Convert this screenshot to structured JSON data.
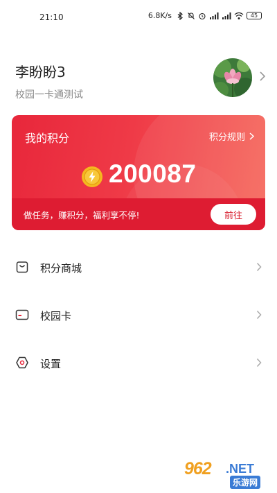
{
  "status_bar": {
    "time": "21:10",
    "speed": "6.8K/s",
    "battery": "45",
    "icons": [
      "bluetooth-icon",
      "mute-icon",
      "alarm-icon",
      "hd-signal-icon",
      "hd-signal-icon",
      "wifi-icon",
      "battery-icon"
    ]
  },
  "profile": {
    "name": "李盼盼3",
    "subtitle": "校园一卡通测试",
    "avatar_icon": "lotus-flower-avatar"
  },
  "points_card": {
    "title": "我的积分",
    "rules_label": "积分规则",
    "value": "200087",
    "slogan": "做任务，赚积分，福利享不停!",
    "go_label": "前往",
    "colors": {
      "primary": "#e8273b",
      "bottom_bar": "#de1c32",
      "coin": "#f5b81f"
    }
  },
  "menu": {
    "items": [
      {
        "label": "积分商城",
        "icon": "shopping-bag-icon"
      },
      {
        "label": "校园卡",
        "icon": "card-icon"
      },
      {
        "label": "设置",
        "icon": "settings-hexagon-icon"
      }
    ]
  },
  "watermark": {
    "number": "962",
    "suffix": ".NET",
    "subtitle": "乐游网"
  }
}
